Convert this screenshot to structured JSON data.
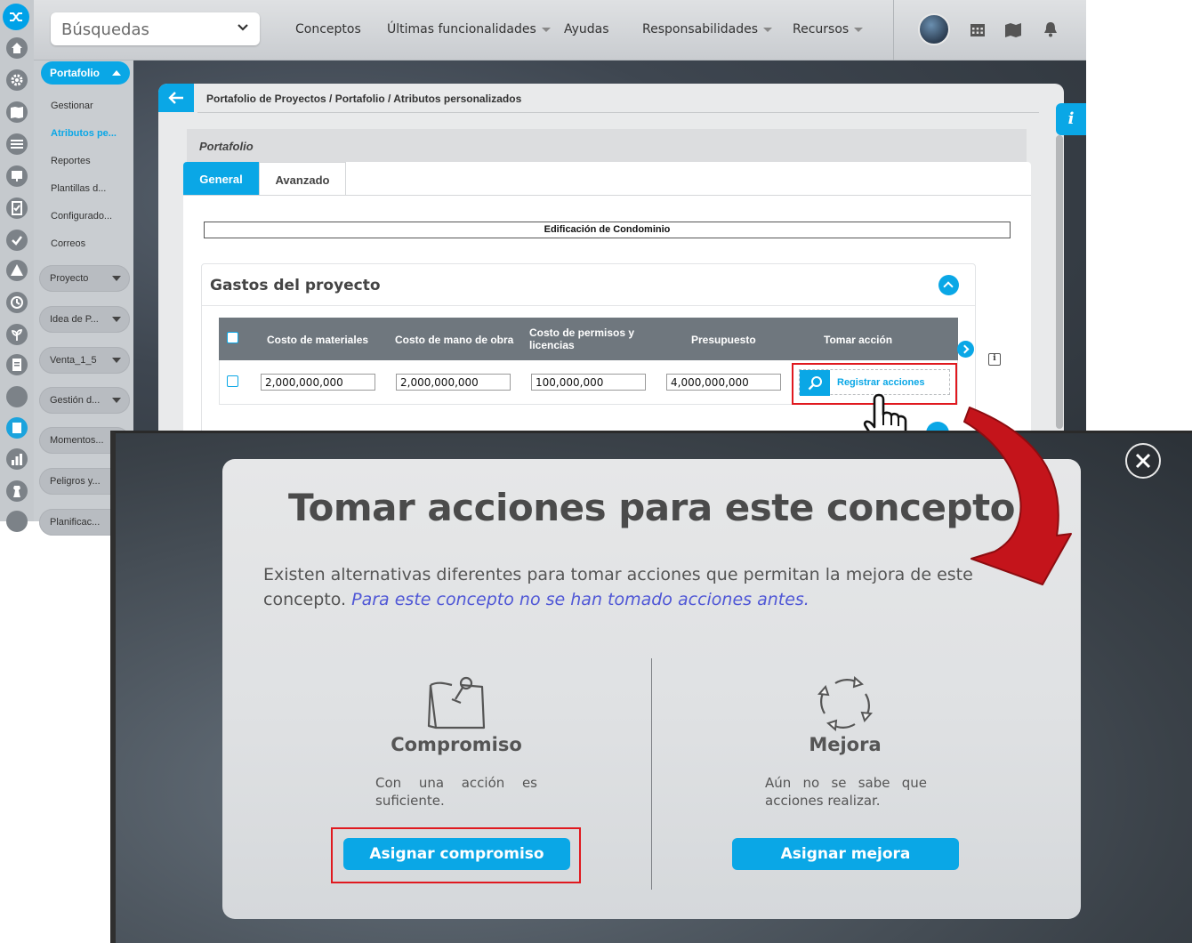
{
  "topbar": {
    "search_placeholder": "Búsquedas",
    "nav": [
      "Conceptos",
      "Últimas funcionalidades",
      "Ayudas",
      "Responsabilidades",
      "Recursos"
    ]
  },
  "menu": {
    "header": "Portafolio",
    "items": [
      "Gestionar",
      "Atributos pe...",
      "Reportes",
      "Plantillas d...",
      "Configurado...",
      "Correos"
    ],
    "groups": [
      "Proyecto",
      "Idea de P...",
      "Venta_1_5",
      "Gestión d...",
      "Momentos...",
      "Peligros y...",
      "Planificac..."
    ]
  },
  "panel": {
    "breadcrumb": "Portafolio de Proyectos / Portafolio / Atributos personalizados",
    "section": "Portafolio",
    "tabs": [
      "General",
      "Avanzado"
    ],
    "record_title": "Edificación de Condominio",
    "info_glyph": "i",
    "row_info_glyph": "i"
  },
  "gastos": {
    "title": "Gastos del proyecto",
    "columns": [
      "Costo de materiales",
      "Costo de mano de obra",
      "Costo de permisos y licencias",
      "Presupuesto",
      "Tomar acción"
    ],
    "row": {
      "costo_materiales": "2,000,000,000",
      "costo_mano_obra": "2,000,000,000",
      "costo_permisos": "100,000,000",
      "presupuesto": "4,000,000,000",
      "accion_label": "Registrar acciones"
    }
  },
  "modal": {
    "title": "Tomar acciones para este concepto",
    "description": "Existen alternativas diferentes para tomar acciones que permitan la mejora de este concepto.",
    "note": "Para este concepto no se han tomado acciones antes.",
    "options": [
      {
        "title": "Compromiso",
        "description": "Con una acción es suficiente.",
        "button": "Asignar compromiso",
        "icon": "pinned-paper-icon"
      },
      {
        "title": "Mejora",
        "description": "Aún no se sabe que acciones realizar.",
        "button": "Asignar mejora",
        "icon": "cycle-arrows-icon"
      }
    ]
  },
  "colors": {
    "accent": "#0aa7e6",
    "highlight": "#e0191f",
    "note": "#4f57d6"
  }
}
